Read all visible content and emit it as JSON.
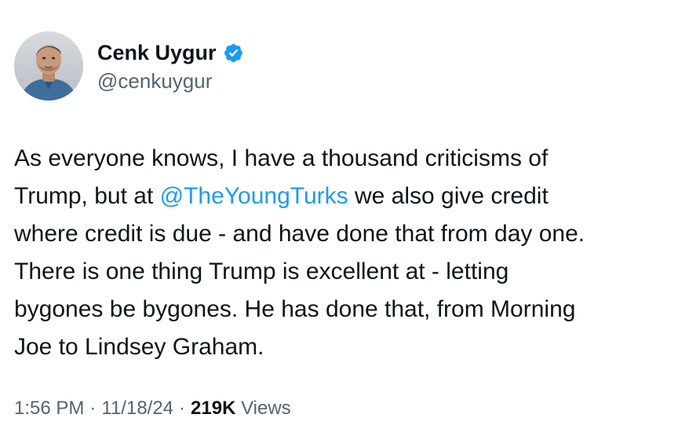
{
  "author": {
    "display_name": "Cenk Uygur",
    "handle": "@cenkuygur",
    "verified_icon": "verified-badge-icon",
    "verified_color": "#1d9bf0"
  },
  "tweet": {
    "lines": [
      {
        "before": "As everyone knows, I have a thousand criticisms of"
      },
      {
        "before": "Trump, but at ",
        "mention": "@TheYoungTurks",
        "after": " we also give credit"
      },
      {
        "before": "where credit is due - and have done that from day one."
      },
      {
        "before": "There is one thing Trump is excellent at - letting"
      },
      {
        "before": "bygones be bygones. He has done that, from Morning"
      },
      {
        "before": "Joe to Lindsey Graham."
      }
    ],
    "mention_color": "#1d9bf0"
  },
  "meta": {
    "time": "1:56 PM",
    "separator": "·",
    "date": "11/18/24",
    "views_count": "219K",
    "views_label": "Views"
  }
}
